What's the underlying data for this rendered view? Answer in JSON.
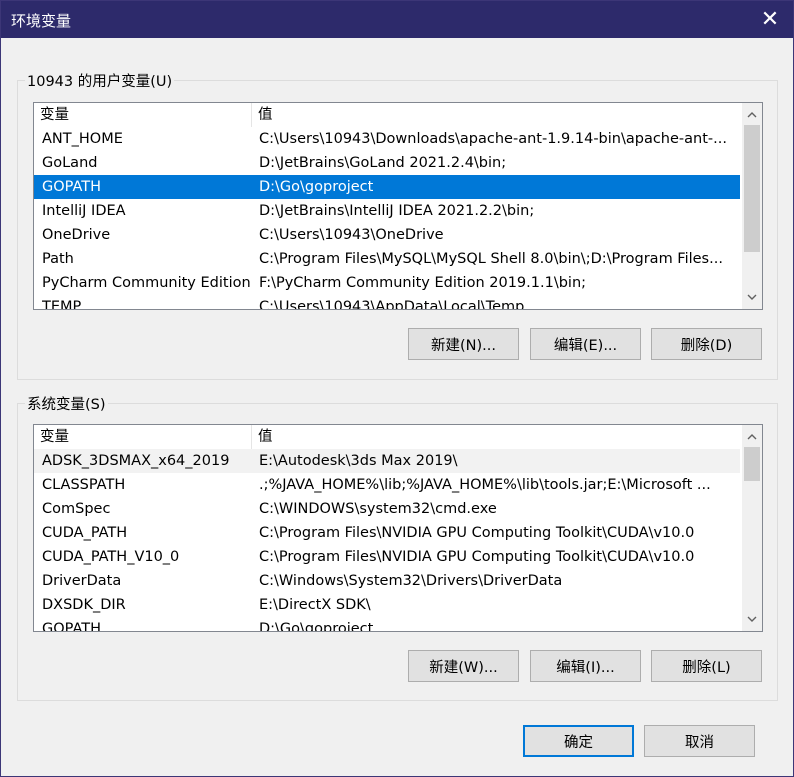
{
  "window": {
    "title": "环境变量",
    "close_glyph": "✕"
  },
  "user_vars": {
    "group_label": "10943 的用户变量(U)",
    "header": {
      "name": "变量",
      "value": "值"
    },
    "rows": [
      {
        "name": "ANT_HOME",
        "value": "C:\\Users\\10943\\Downloads\\apache-ant-1.9.14-bin\\apache-ant-..."
      },
      {
        "name": "GoLand",
        "value": "D:\\JetBrains\\GoLand 2021.2.4\\bin;"
      },
      {
        "name": "GOPATH",
        "value": "D:\\Go\\goproject"
      },
      {
        "name": "IntelliJ IDEA",
        "value": "D:\\JetBrains\\IntelliJ IDEA 2021.2.2\\bin;"
      },
      {
        "name": "OneDrive",
        "value": "C:\\Users\\10943\\OneDrive"
      },
      {
        "name": "Path",
        "value": "C:\\Program Files\\MySQL\\MySQL Shell 8.0\\bin\\;D:\\Program Files..."
      },
      {
        "name": "PyCharm Community Edition",
        "value": "F:\\PyCharm Community Edition 2019.1.1\\bin;"
      },
      {
        "name": "TEMP",
        "value": "C:\\Users\\10943\\AppData\\Local\\Temp"
      }
    ],
    "selected_index": 2,
    "buttons": {
      "new": "新建(N)...",
      "edit": "编辑(E)...",
      "delete": "删除(D)"
    }
  },
  "system_vars": {
    "group_label": "系统变量(S)",
    "header": {
      "name": "变量",
      "value": "值"
    },
    "rows": [
      {
        "name": "ADSK_3DSMAX_x64_2019",
        "value": "E:\\Autodesk\\3ds Max 2019\\"
      },
      {
        "name": "CLASSPATH",
        "value": ".;%JAVA_HOME%\\lib;%JAVA_HOME%\\lib\\tools.jar;E:\\Microsoft ..."
      },
      {
        "name": "ComSpec",
        "value": "C:\\WINDOWS\\system32\\cmd.exe"
      },
      {
        "name": "CUDA_PATH",
        "value": "C:\\Program Files\\NVIDIA GPU Computing Toolkit\\CUDA\\v10.0"
      },
      {
        "name": "CUDA_PATH_V10_0",
        "value": "C:\\Program Files\\NVIDIA GPU Computing Toolkit\\CUDA\\v10.0"
      },
      {
        "name": "DriverData",
        "value": "C:\\Windows\\System32\\Drivers\\DriverData"
      },
      {
        "name": "DXSDK_DIR",
        "value": "E:\\DirectX SDK\\"
      },
      {
        "name": "GOPATH",
        "value": "D:\\Go\\goproject"
      }
    ],
    "hover_index": 0,
    "buttons": {
      "new": "新建(W)...",
      "edit": "编辑(I)...",
      "delete": "删除(L)"
    }
  },
  "footer": {
    "ok": "确定",
    "cancel": "取消"
  },
  "colors": {
    "titlebar": "#2d2a6b",
    "selection": "#0078d7",
    "accent_border": "#0078d7"
  },
  "icons": {
    "close": "close-icon",
    "scroll_up": "chevron-up-icon",
    "scroll_down": "chevron-down-icon"
  }
}
